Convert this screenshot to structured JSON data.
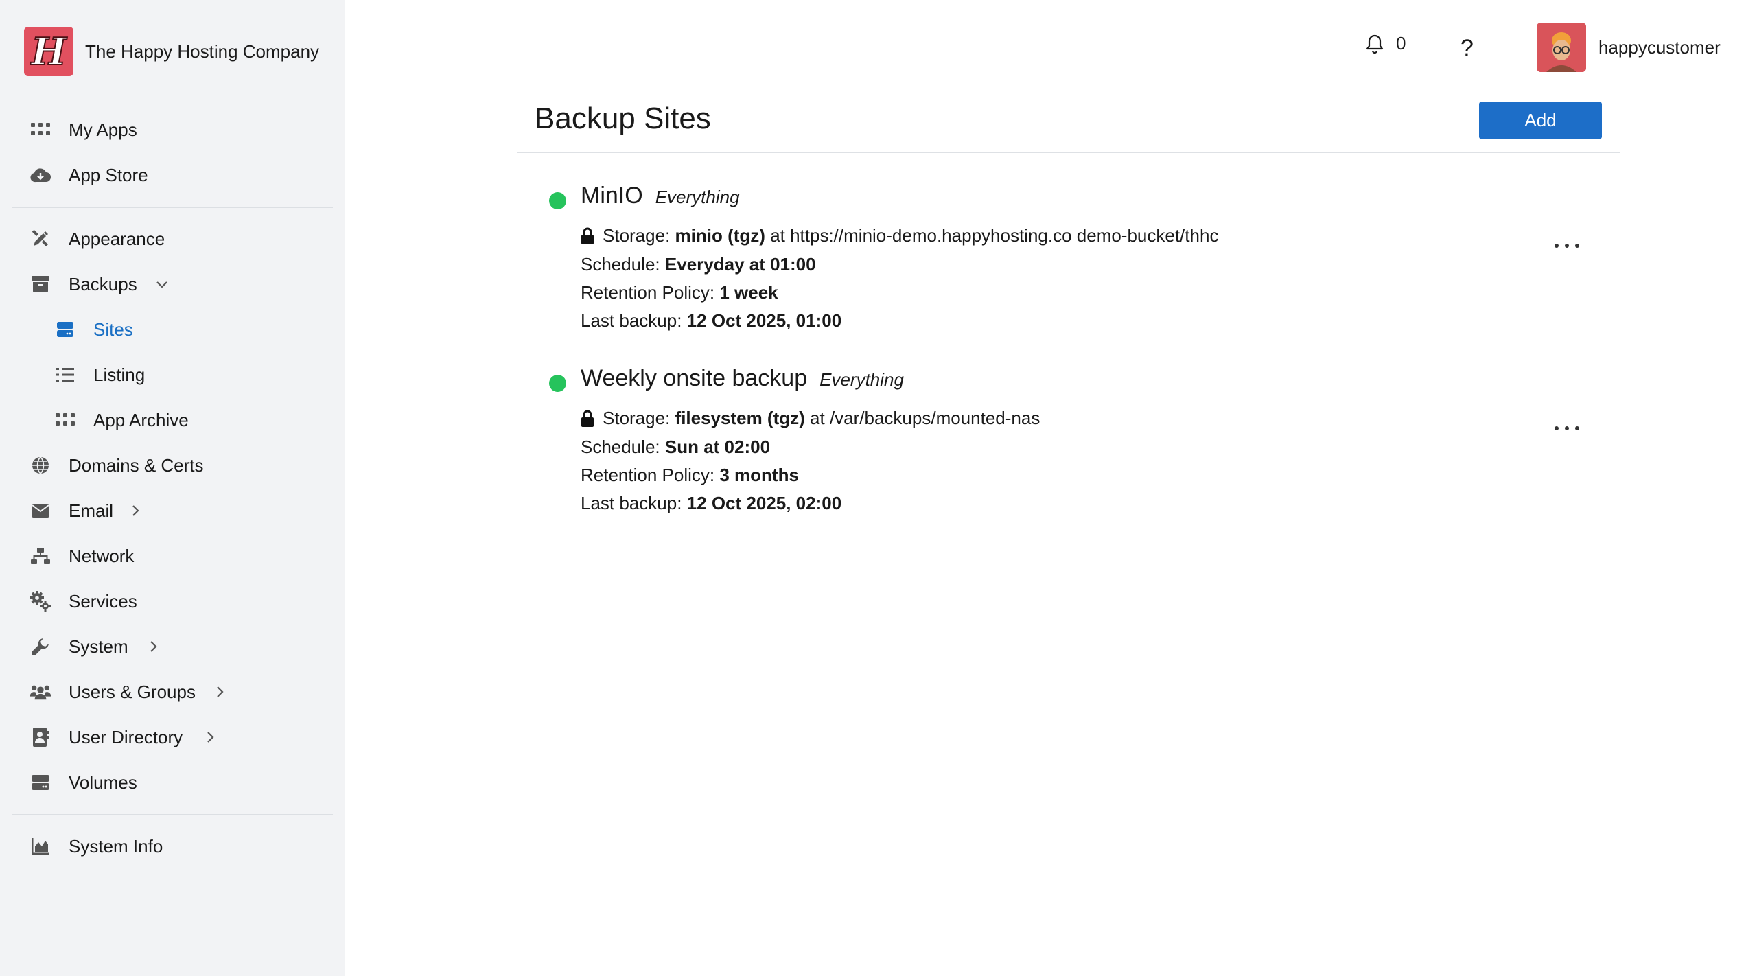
{
  "brand": {
    "name": "The Happy Hosting Company",
    "logo_letter": "H",
    "logo_color": "#e1505f"
  },
  "sidebar": {
    "items": [
      {
        "id": "my-apps",
        "label": "My Apps",
        "icon": "grid-icon"
      },
      {
        "id": "app-store",
        "label": "App Store",
        "icon": "cloud-download-icon"
      },
      {
        "id": "appearance",
        "label": "Appearance",
        "icon": "paint-brush-icon"
      },
      {
        "id": "backups",
        "label": "Backups",
        "icon": "archive-box-icon",
        "expanded": true
      },
      {
        "id": "sites",
        "label": "Sites",
        "icon": "server-icon",
        "active": true
      },
      {
        "id": "listing",
        "label": "Listing",
        "icon": "list-icon"
      },
      {
        "id": "app-archive",
        "label": "App Archive",
        "icon": "grid-icon"
      },
      {
        "id": "domains",
        "label": "Domains & Certs",
        "icon": "globe-icon"
      },
      {
        "id": "email",
        "label": "Email",
        "icon": "envelope-icon"
      },
      {
        "id": "network",
        "label": "Network",
        "icon": "network-icon"
      },
      {
        "id": "services",
        "label": "Services",
        "icon": "gears-icon"
      },
      {
        "id": "system",
        "label": "System",
        "icon": "wrench-icon"
      },
      {
        "id": "users-groups",
        "label": "Users & Groups",
        "icon": "users-icon"
      },
      {
        "id": "user-directory",
        "label": "User Directory",
        "icon": "address-book-icon"
      },
      {
        "id": "volumes",
        "label": "Volumes",
        "icon": "hard-drive-icon"
      },
      {
        "id": "system-info",
        "label": "System Info",
        "icon": "chart-area-icon"
      }
    ]
  },
  "topbar": {
    "notification_count": "0",
    "help_label": "?",
    "username": "happycustomer"
  },
  "main": {
    "title": "Backup Sites",
    "add_label": "Add",
    "sites": [
      {
        "name": "MinIO",
        "scope": "Everything",
        "status_color": "#26c35c",
        "storage_label": "Storage:",
        "storage_type": "minio (tgz)",
        "storage_at": "at https://minio-demo.happyhosting.co demo-bucket/thhc",
        "schedule_label": "Schedule:",
        "schedule": "Everyday at 01:00",
        "retention_label": "Retention Policy:",
        "retention": "1 week",
        "last_label": "Last backup:",
        "last_backup": "12 Oct 2025, 01:00"
      },
      {
        "name": "Weekly onsite backup",
        "scope": "Everything",
        "status_color": "#26c35c",
        "storage_label": "Storage:",
        "storage_type": "filesystem (tgz)",
        "storage_at": "at /var/backups/mounted-nas",
        "schedule_label": "Schedule:",
        "schedule": "Sun at 02:00",
        "retention_label": "Retention Policy:",
        "retention": "3 months",
        "last_label": "Last backup:",
        "last_backup": "12 Oct 2025, 02:00"
      }
    ]
  }
}
